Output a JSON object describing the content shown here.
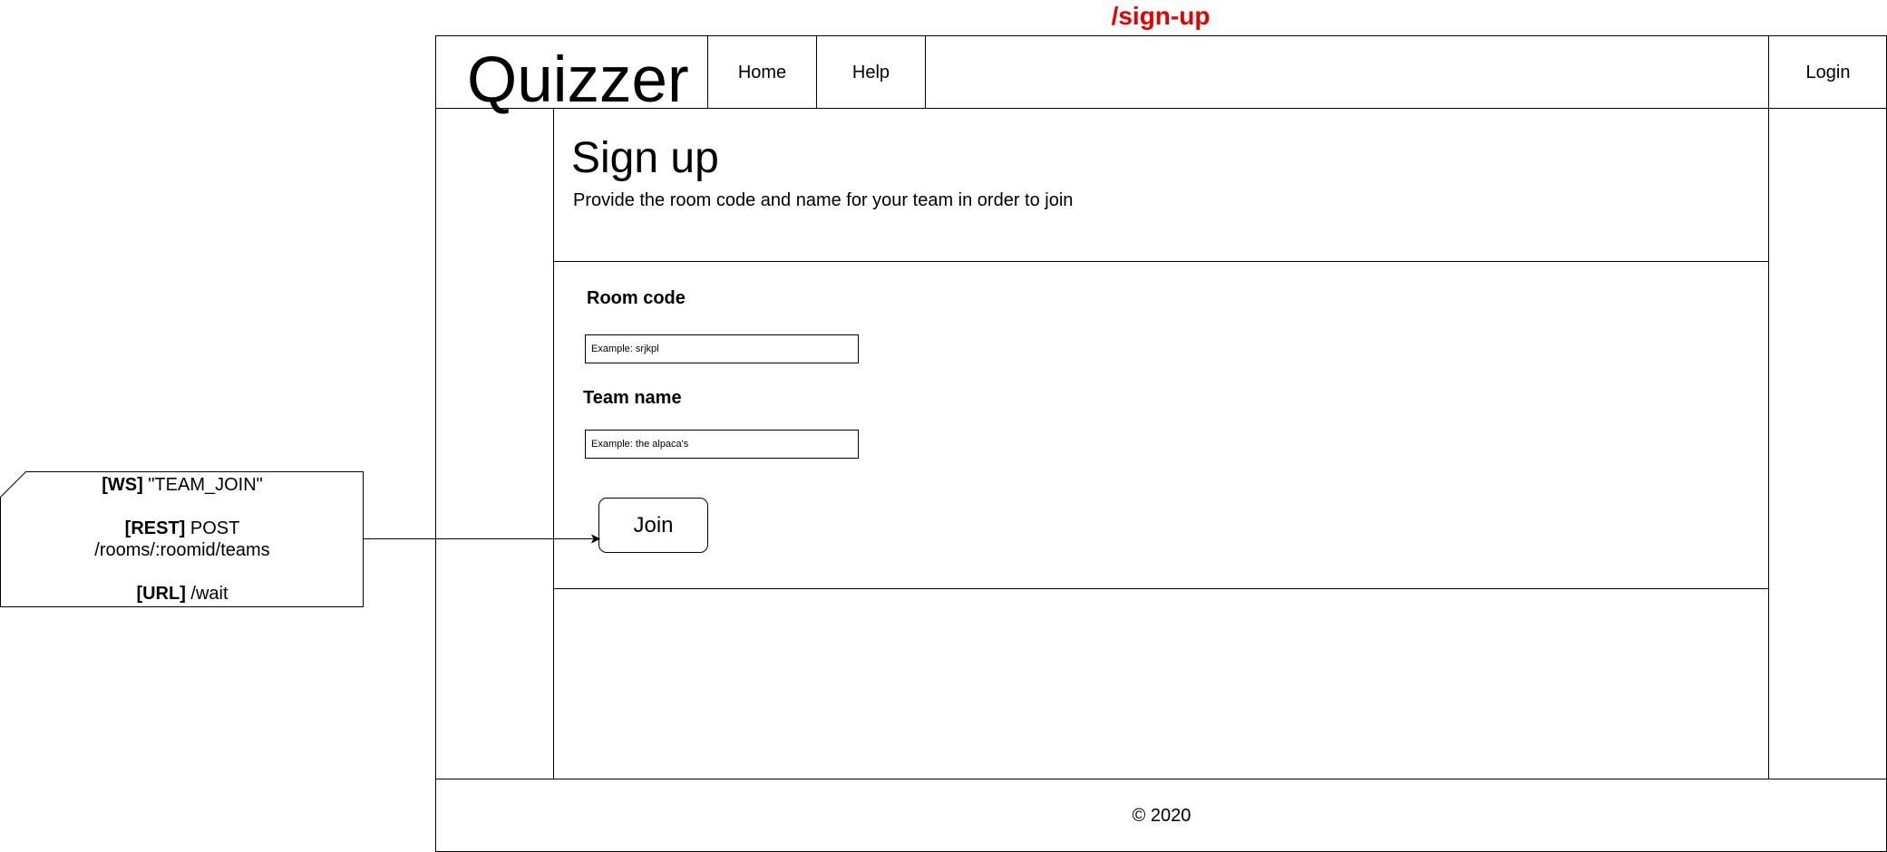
{
  "route": "/sign-up",
  "header": {
    "logo": "Quizzer",
    "nav": {
      "home": "Home",
      "help": "Help"
    },
    "login": "Login"
  },
  "main": {
    "title": "Sign up",
    "subtitle": "Provide the room code and name for your team in order to join",
    "form": {
      "room_code_label": "Room code",
      "room_code_placeholder": "Example: srjkpl",
      "team_name_label": "Team name",
      "team_name_placeholder": "Example: the alpaca's",
      "join_label": "Join"
    }
  },
  "footer": {
    "copyright": "© 2020"
  },
  "note": {
    "ws_tag": "[WS]",
    "ws_value": " \"TEAM_JOIN\"",
    "rest_tag": "[REST]",
    "rest_value": " POST",
    "rest_path": "/rooms/:roomid/teams",
    "url_tag": "[URL]",
    "url_value": " /wait"
  },
  "colors": {
    "route_title": "#e60000",
    "line": "#000000"
  }
}
